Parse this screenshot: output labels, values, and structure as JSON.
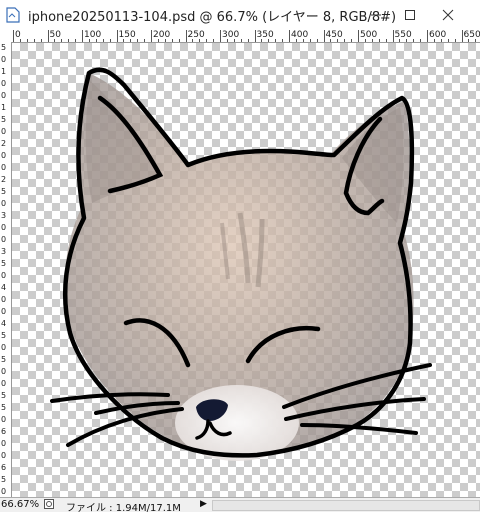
{
  "window": {
    "title": "iphone20250113-104.psd @ 66.7% (レイヤー 8, RGB/8#)",
    "buttons": {
      "minimize": "minimize-icon",
      "maximize": "maximize-icon",
      "close": "close-icon"
    }
  },
  "ruler_top": [
    "0",
    "50",
    "100",
    "150",
    "200",
    "250",
    "300",
    "350",
    "400",
    "450",
    "500",
    "550",
    "600",
    "650"
  ],
  "ruler_left": [
    "5",
    "0",
    "1",
    "0",
    "0",
    "1",
    "5",
    "0",
    "2",
    "0",
    "0",
    "2",
    "5",
    "0",
    "3",
    "0",
    "0",
    "3",
    "5",
    "0",
    "4",
    "0",
    "0",
    "4",
    "5",
    "0",
    "5",
    "0",
    "0",
    "5",
    "5",
    "0",
    "6",
    "0",
    "0",
    "6",
    "5",
    "0"
  ],
  "status": {
    "zoom": "66.67%",
    "file_info": "ファイル : 1.94M/17.1M"
  },
  "colors": {
    "line": "#000000",
    "fur": "#a99b93",
    "fur_light": "#d8c2b3",
    "nose": "#141a33"
  }
}
